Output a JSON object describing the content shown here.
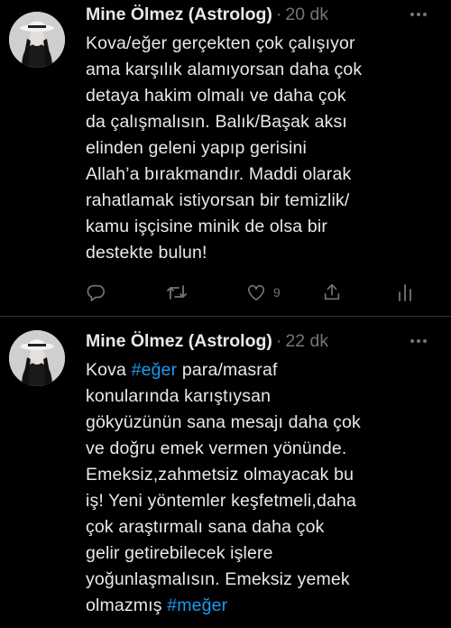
{
  "tweets": [
    {
      "author": "Mine Ölmez (Astrolog)",
      "time": "20 dk",
      "text": "Kova/eğer gerçekten çok çalışıyor\nama karşılık alamıyorsan daha çok\ndetaya hakim olmalı ve daha çok\nda çalışmalısın. Balık/Başak aksı\nelinden geleni yapıp gerisini\nAllah’a bırakmandır. Maddi olarak\nrahatlamak istiyorsan bir temizlik/\nkamu işçisine minik de olsa bir\ndestekte bulun!",
      "like_count": "9"
    },
    {
      "author": "Mine Ölmez (Astrolog)",
      "time": "22 dk",
      "text_parts": {
        "p1": "Kova ",
        "tag1": "#eğer",
        "p2": " para/masraf\nkonularında karıştıysan\ngökyüzünün sana mesajı daha çok\nve doğru emek vermen yönünde.\nEmeksiz,zahmetsiz olmayacak bu\niş! Yeni yöntemler keşfetmeli,daha\nçok araştırmalı sana daha çok\ngelir getirebilecek işlere\nyoğunlaşmalısın. Emeksiz yemek\nolmazmış ",
        "tag2": "#meğer"
      }
    }
  ],
  "separator": "·",
  "icons": {
    "more": "more-dots-icon",
    "reply": "reply-icon",
    "retweet": "retweet-icon",
    "like": "heart-icon",
    "share": "share-icon",
    "analytics": "analytics-icon"
  },
  "colors": {
    "background": "#000000",
    "text": "#e7e9ea",
    "muted": "#71767b",
    "hashtag": "#1d9bf0",
    "divider": "#2f3336"
  }
}
